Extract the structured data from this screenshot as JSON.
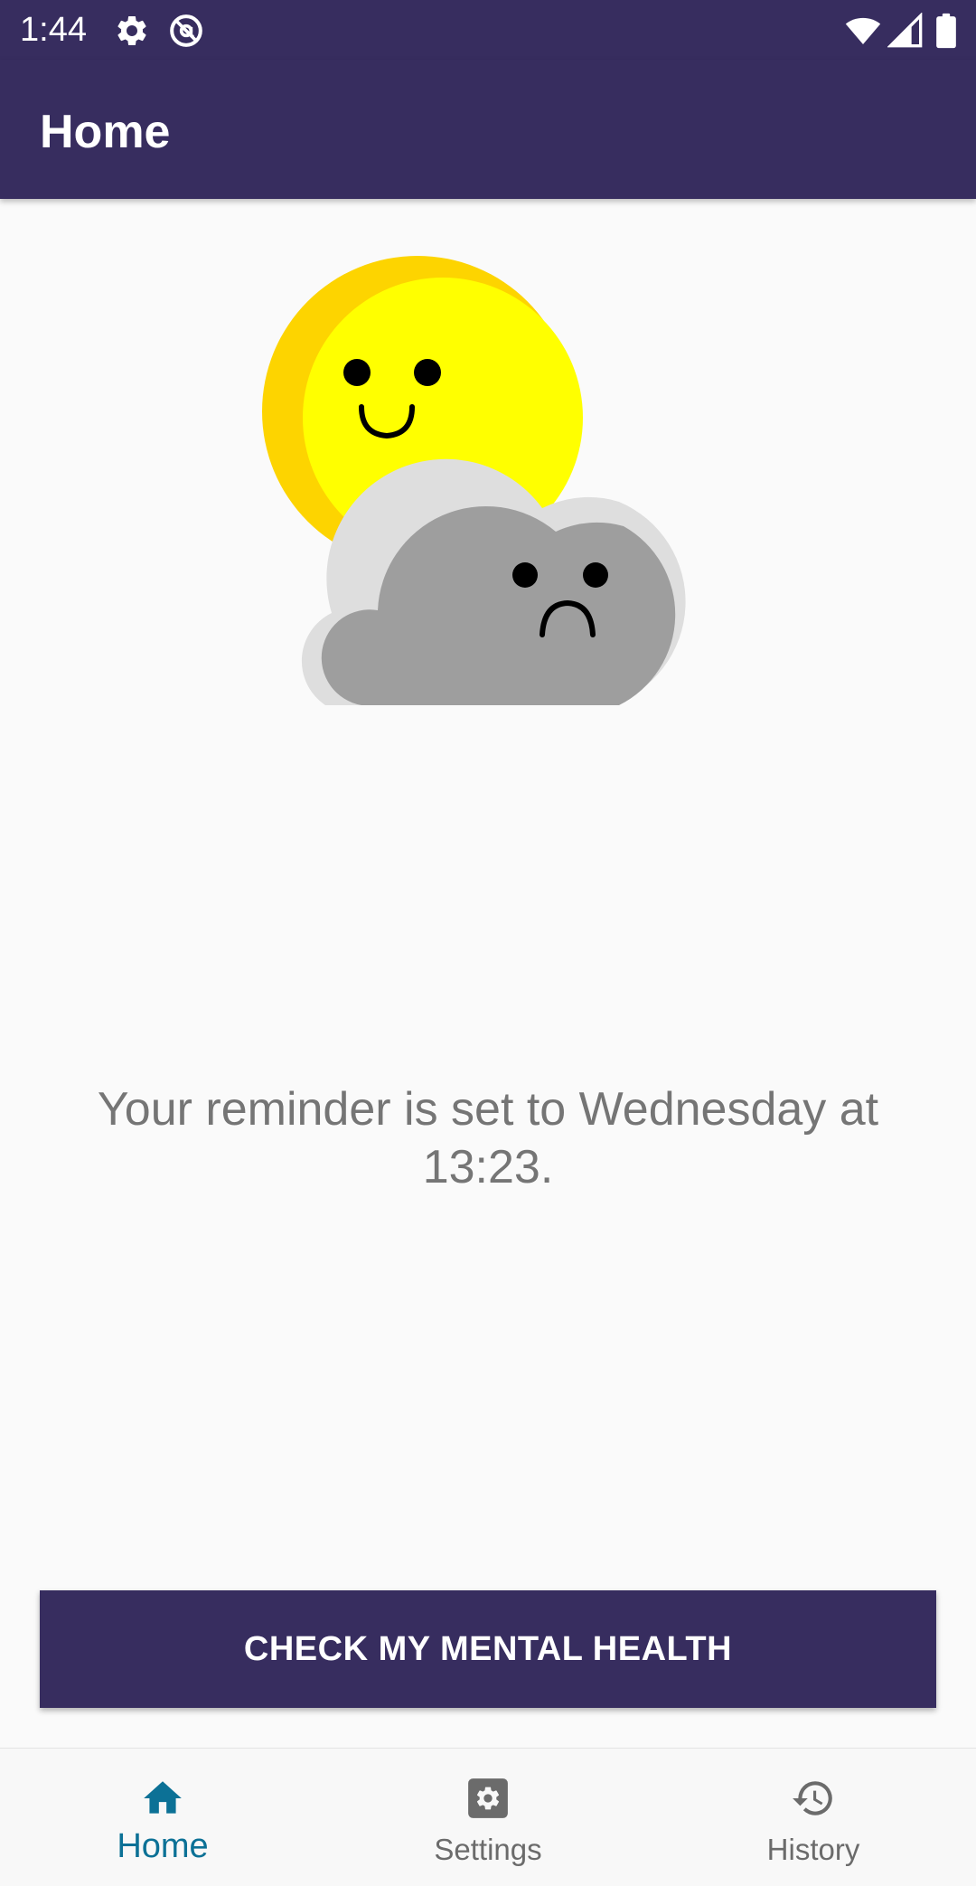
{
  "status_bar": {
    "time": "1:44",
    "left_icons": [
      "gear-icon",
      "at-sign-icon"
    ],
    "right_icons": [
      "wifi-icon",
      "signal-icon",
      "battery-icon"
    ]
  },
  "app_bar": {
    "title": "Home"
  },
  "hero": {
    "image": "sun-and-cloud-mood-illustration"
  },
  "reminder": {
    "text": "Your reminder is set to Wednesday at 13:23."
  },
  "cta": {
    "label": "CHECK MY MENTAL HEALTH"
  },
  "bottom_nav": {
    "active": "Home",
    "items": [
      {
        "label": "Home",
        "icon": "home-icon"
      },
      {
        "label": "Settings",
        "icon": "gear-icon"
      },
      {
        "label": "History",
        "icon": "history-icon"
      }
    ]
  },
  "colors": {
    "primary": "#372d5f",
    "active_nav": "#0c7196",
    "inactive_nav": "#6b6b6b",
    "background": "#fafafa",
    "reminder_text": "#757575"
  }
}
